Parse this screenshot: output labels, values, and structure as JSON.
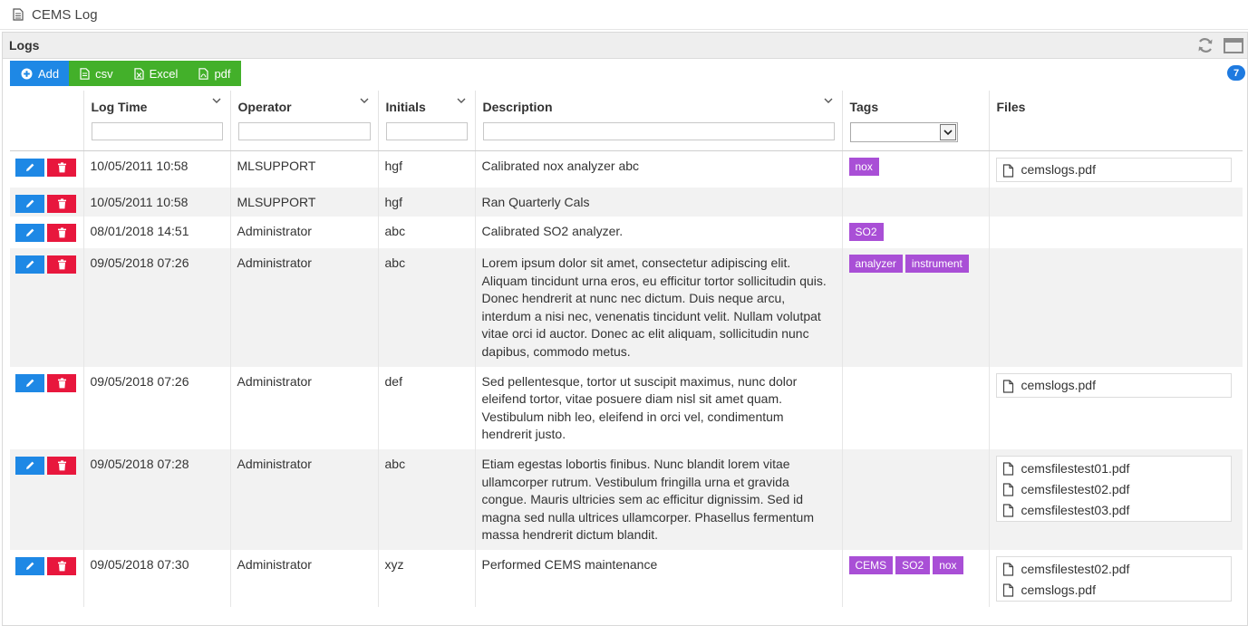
{
  "window": {
    "title": "CEMS Log"
  },
  "panel": {
    "title": "Logs"
  },
  "toolbar": {
    "add_label": "Add",
    "csv_label": "csv",
    "excel_label": "Excel",
    "pdf_label": "pdf",
    "count": "7"
  },
  "columns": {
    "log_time": "Log Time",
    "operator": "Operator",
    "initials": "Initials",
    "description": "Description",
    "tags": "Tags",
    "files": "Files"
  },
  "colors": {
    "add": "#1e88e5",
    "export": "#43b02a",
    "edit": "#1e88e5",
    "delete": "#e8173d",
    "tag": "#a94fd6",
    "badge": "#1e7ae0"
  },
  "rows": [
    {
      "time": "10/05/2011 10:58",
      "operator": "MLSUPPORT",
      "initials": "hgf",
      "description": "Calibrated nox analyzer abc",
      "tags": [
        "nox"
      ],
      "files": [
        "cemslogs.pdf"
      ]
    },
    {
      "time": "10/05/2011 10:58",
      "operator": "MLSUPPORT",
      "initials": "hgf",
      "description": "Ran Quarterly Cals",
      "tags": [],
      "files": []
    },
    {
      "time": "08/01/2018 14:51",
      "operator": "Administrator",
      "initials": "abc",
      "description": "Calibrated SO2 analyzer.",
      "tags": [
        "SO2"
      ],
      "files": []
    },
    {
      "time": "09/05/2018 07:26",
      "operator": "Administrator",
      "initials": "abc",
      "description": "Lorem ipsum dolor sit amet, consectetur adipiscing elit. Aliquam tincidunt urna eros, eu efficitur tortor sollicitudin quis. Donec hendrerit at nunc nec dictum. Duis neque arcu, interdum a nisi nec, venenatis tincidunt velit. Nullam volutpat vitae orci id auctor. Donec ac elit aliquam, sollicitudin nunc dapibus, commodo metus.",
      "tags": [
        "analyzer",
        "instrument"
      ],
      "files": []
    },
    {
      "time": "09/05/2018 07:26",
      "operator": "Administrator",
      "initials": "def",
      "description": "Sed pellentesque, tortor ut suscipit maximus, nunc dolor eleifend tortor, vitae posuere diam nisl sit amet quam. Vestibulum nibh leo, eleifend in orci vel, condimentum hendrerit justo.",
      "tags": [],
      "files": [
        "cemslogs.pdf"
      ]
    },
    {
      "time": "09/05/2018 07:28",
      "operator": "Administrator",
      "initials": "abc",
      "description": "Etiam egestas lobortis finibus. Nunc blandit lorem vitae ullamcorper rutrum. Vestibulum fringilla urna et gravida congue. Mauris ultricies sem ac efficitur dignissim. Sed id magna sed nulla ultrices ullamcorper. Phasellus fermentum massa hendrerit dictum blandit.",
      "tags": [],
      "files": [
        "cemsfilestest01.pdf",
        "cemsfilestest02.pdf",
        "cemsfilestest03.pdf"
      ]
    },
    {
      "time": "09/05/2018 07:30",
      "operator": "Administrator",
      "initials": "xyz",
      "description": "Performed CEMS maintenance",
      "tags": [
        "CEMS",
        "SO2",
        "nox"
      ],
      "files": [
        "cemsfilestest02.pdf",
        "cemslogs.pdf"
      ]
    }
  ]
}
